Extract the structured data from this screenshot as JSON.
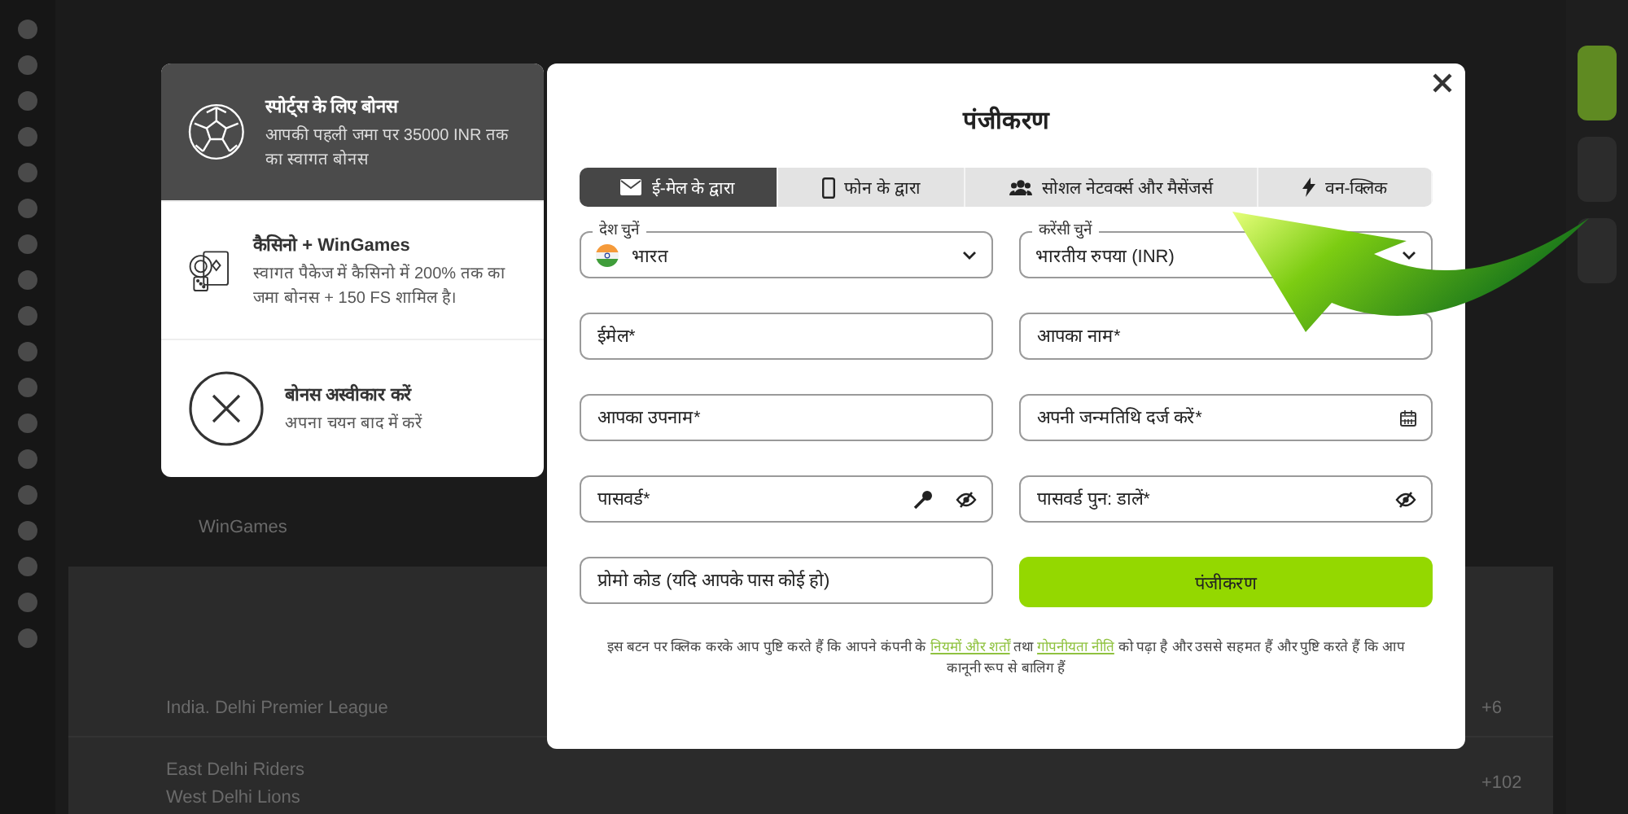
{
  "background": {
    "card_label": "WinGames",
    "league": "India. Delhi Premier League",
    "teams": [
      "East Delhi Riders",
      "West Delhi Lions"
    ],
    "markets": [
      "+6",
      "+102"
    ]
  },
  "bonus_options": [
    {
      "kind": "sports",
      "title": "स्पोर्ट्स के लिए बोनस",
      "description": "आपकी पहली जमा पर 35000 INR तक का स्वागत बोनस",
      "selected": true
    },
    {
      "kind": "casino",
      "title": "कैसिनो + WinGames",
      "description": "स्वागत पैकेज में कैसिनो में 200% तक का जमा बोनस + 150 FS शामिल है।",
      "selected": false
    },
    {
      "kind": "decline",
      "title": "बोनस अस्वीकार करें",
      "description": "अपना चयन बाद में करें",
      "selected": false
    }
  ],
  "modal": {
    "title": "पंजीकरण",
    "tabs": [
      {
        "label": "ई-मेल के द्वारा",
        "kind": "email",
        "selected": true
      },
      {
        "label": "फोन के द्वारा",
        "kind": "phone",
        "selected": false
      },
      {
        "label": "सोशल नेटवर्क्स और मैसेंजर्स",
        "kind": "social",
        "selected": false
      },
      {
        "label": "वन-क्लिक",
        "kind": "oneclick",
        "selected": false
      }
    ],
    "fields": [
      {
        "kind": "select",
        "label": "देश चुनें",
        "value": "भारत",
        "flag": true
      },
      {
        "kind": "select",
        "label": "करेंसी चुनें",
        "value": "भारतीय रुपया (INR)",
        "flag": false
      },
      {
        "kind": "text",
        "placeholder": "ईमेल*"
      },
      {
        "kind": "text",
        "placeholder": "आपका नाम*"
      },
      {
        "kind": "text",
        "placeholder": "आपका उपनाम*"
      },
      {
        "kind": "date",
        "placeholder": "अपनी जन्मतिथि दर्ज करें*"
      },
      {
        "kind": "password",
        "placeholder": "पासवर्ड*",
        "generate": true
      },
      {
        "kind": "password",
        "placeholder": "पासवर्ड पुन: डालें*",
        "generate": false
      },
      {
        "kind": "text",
        "placeholder": "प्रोमो कोड (यदि आपके पास कोई हो)"
      },
      {
        "kind": "submit",
        "label": "पंजीकरण"
      }
    ],
    "consent": [
      {
        "kind": "text",
        "text": "इस बटन पर क्लिक करके आप पुष्टि करते हैं कि आपने कंपनी के "
      },
      {
        "kind": "link",
        "text": "नियमों और शर्तों"
      },
      {
        "kind": "text",
        "text": " तथा "
      },
      {
        "kind": "link",
        "text": "गोपनीयता नीति"
      },
      {
        "kind": "text",
        "text": " को पढ़ा है और उससे सहमत हैं और पुष्टि करते हैं कि आप कानूनी रूप से बालिग हैं"
      }
    ]
  }
}
